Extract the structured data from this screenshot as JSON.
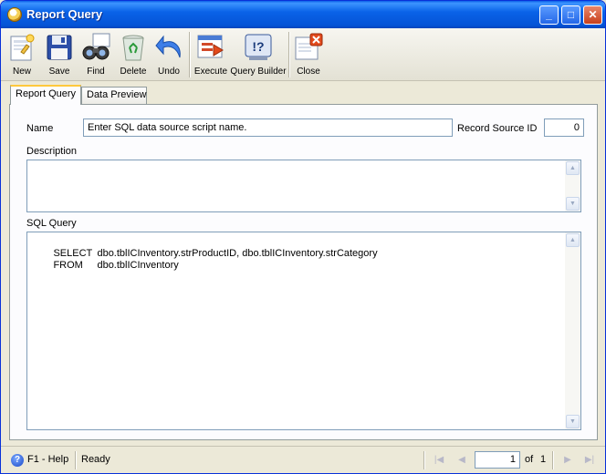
{
  "window": {
    "title": "Report Query",
    "controls": {
      "minimize": "_",
      "maximize": "□",
      "close": "✕"
    }
  },
  "toolbar": {
    "new": "New",
    "save": "Save",
    "find": "Find",
    "delete": "Delete",
    "undo": "Undo",
    "execute": "Execute",
    "query_builder": "Query Builder",
    "close": "Close"
  },
  "tabs": [
    {
      "label": "Report Query",
      "active": true
    },
    {
      "label": "Data Preview",
      "active": false
    }
  ],
  "form": {
    "name_label": "Name",
    "name_value": "Enter SQL data source script name.",
    "record_source_id_label": "Record Source ID",
    "record_source_id_value": "0",
    "description_label": "Description",
    "description_value": "",
    "sql_label": "SQL Query",
    "sql_lines": [
      {
        "keyword": "SELECT",
        "text": "dbo.tblICInventory.strProductID, dbo.tblICInventory.strCategory"
      },
      {
        "keyword": "FROM",
        "text": "dbo.tblICInventory"
      }
    ]
  },
  "status": {
    "help": "F1 - Help",
    "state": "Ready",
    "page": "1",
    "of_label": "of",
    "total_pages": "1"
  },
  "icons": {
    "app": "report-app-icon",
    "help": "help-icon",
    "new": "new-document-icon",
    "save": "floppy-disk-icon",
    "find": "binoculars-icon",
    "delete": "recycle-bin-icon",
    "undo": "undo-arrow-icon",
    "execute": "execute-icon",
    "query_builder": "query-builder-icon",
    "close": "close-form-icon"
  },
  "colors": {
    "titlebar": "#0554d6",
    "window_bg": "#ece9d8",
    "field_border": "#7f9db9",
    "active_tab_highlight": "#ffc83c"
  }
}
